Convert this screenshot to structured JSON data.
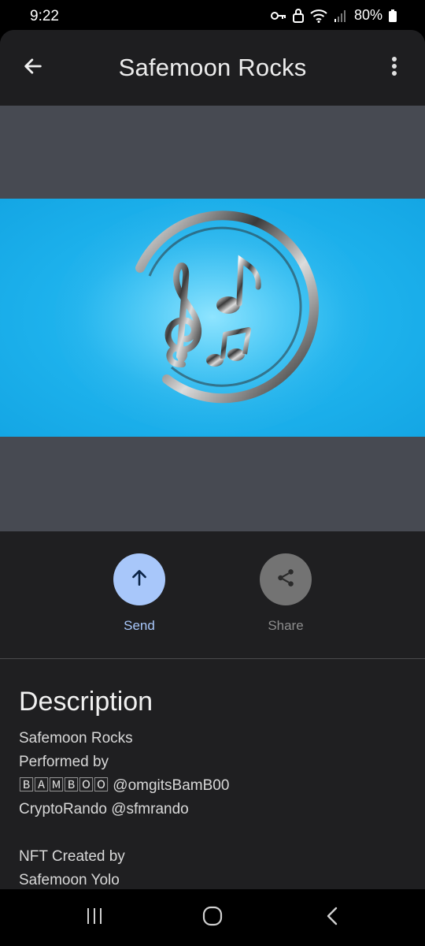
{
  "status_bar": {
    "time": "9:22",
    "battery": "80%",
    "icons": [
      "key-icon",
      "lock-notification-icon",
      "wifi-icon",
      "signal-icon",
      "battery-icon"
    ]
  },
  "toolbar": {
    "title": "Safemoon Rocks",
    "back_icon": "arrow-back-icon",
    "more_icon": "more-vert-icon"
  },
  "artwork": {
    "background_color": "#1fb4ee",
    "icon": "music-notes-icon"
  },
  "actions": [
    {
      "label": "Send",
      "icon": "arrow-up-icon",
      "color": "#a8c7fa"
    },
    {
      "label": "Share",
      "icon": "share-icon",
      "color": "#737373"
    }
  ],
  "description": {
    "heading": "Description",
    "lines": [
      "Safemoon Rocks",
      "Performed by",
      "🄱🄰🄼🄱🄾🄾 @omgitsBamB00",
      "CryptoRando @sfmrando",
      "",
      "NFT Created by",
      "Safemoon Yolo"
    ]
  },
  "nav_bar": {
    "icons": [
      "recents-icon",
      "home-icon",
      "back-icon"
    ]
  }
}
